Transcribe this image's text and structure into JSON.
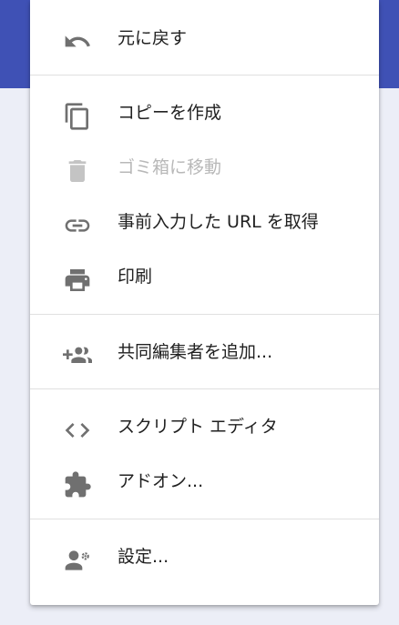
{
  "menu": {
    "items": [
      {
        "label": "元に戻す",
        "icon": "undo-icon",
        "disabled": false
      },
      {
        "label": "コピーを作成",
        "icon": "copy-icon",
        "disabled": false
      },
      {
        "label": "ゴミ箱に移動",
        "icon": "trash-icon",
        "disabled": true
      },
      {
        "label": "事前入力した URL を取得",
        "icon": "link-icon",
        "disabled": false
      },
      {
        "label": "印刷",
        "icon": "print-icon",
        "disabled": false
      },
      {
        "label": "共同編集者を追加...",
        "icon": "add-people-icon",
        "disabled": false
      },
      {
        "label": "スクリプト エディタ",
        "icon": "code-icon",
        "disabled": false
      },
      {
        "label": "アドオン...",
        "icon": "puzzle-icon",
        "disabled": false
      },
      {
        "label": "設定...",
        "icon": "settings-person-icon",
        "disabled": false
      }
    ]
  },
  "colors": {
    "header": "#3f51b5",
    "background": "#eceef7",
    "menu": "#ffffff",
    "icon": "#707070",
    "text": "#212121",
    "disabled_text": "#b8b8b8",
    "divider": "#e0e0e0"
  }
}
